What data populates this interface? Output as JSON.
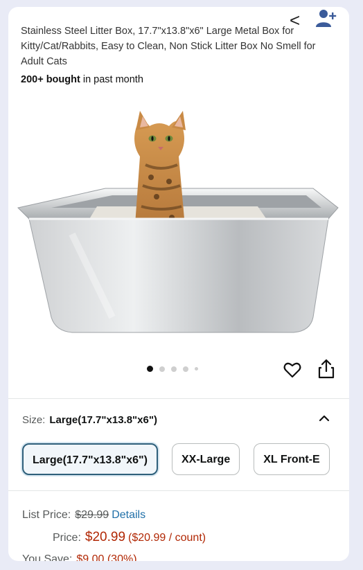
{
  "header": {
    "back_glyph": "<",
    "add_user_icon": "add-user-icon"
  },
  "product": {
    "title": "Stainless Steel Litter Box, 17.7\"x13.8\"x6\" Large Metal Box for Kitty/Cat/Rabbits, Easy to Clean, Non Stick Litter Box No Smell for Adult Cats",
    "bought_bold": "200+ bought",
    "bought_rest": " in past month",
    "image_count": 5,
    "image_index": 1
  },
  "size": {
    "label": "Size:",
    "selected": "Large(17.7\"x13.8\"x6\")",
    "options": [
      "Large(17.7\"x13.8\"x6\")",
      "XX-Large",
      "XL Front-E"
    ]
  },
  "pricing": {
    "list_label": "List Price:",
    "list_value": "$29.99",
    "details_link": "Details",
    "price_label": "Price:",
    "price_value": "$20.99",
    "unit_price": "($20.99 / count)",
    "save_label": "You Save:",
    "save_value": "$9.00 (30%)"
  },
  "colors": {
    "price_red": "#b12704",
    "link_blue": "#1f6fa8",
    "selected_border": "#2e5f7a"
  }
}
